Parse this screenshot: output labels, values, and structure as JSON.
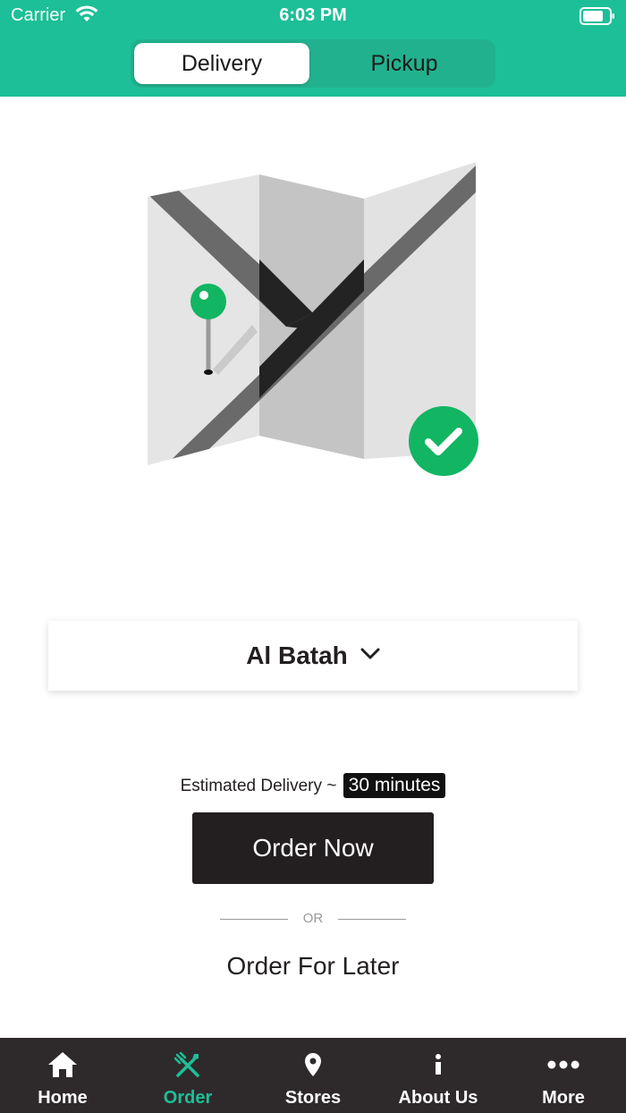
{
  "status_bar": {
    "carrier": "Carrier",
    "time": "6:03 PM"
  },
  "mode_switch": {
    "options": [
      "Delivery",
      "Pickup"
    ],
    "selected": "Delivery"
  },
  "location": {
    "name": "Al Batah"
  },
  "estimate": {
    "prefix": "Estimated Delivery ~",
    "value": "30 minutes"
  },
  "actions": {
    "order_now": "Order Now",
    "or": "OR",
    "order_later": "Order For Later"
  },
  "tabbar": {
    "items": [
      {
        "label": "Home",
        "icon": "home-icon"
      },
      {
        "label": "Order",
        "icon": "fork-knife-icon"
      },
      {
        "label": "Stores",
        "icon": "location-pin-icon"
      },
      {
        "label": "About Us",
        "icon": "info-icon"
      },
      {
        "label": "More",
        "icon": "more-dots-icon"
      }
    ],
    "active": "Order"
  },
  "colors": {
    "brand": "#1dbf98",
    "dark": "#231f20",
    "tabbar": "#2e2a2b",
    "check": "#12b562"
  }
}
